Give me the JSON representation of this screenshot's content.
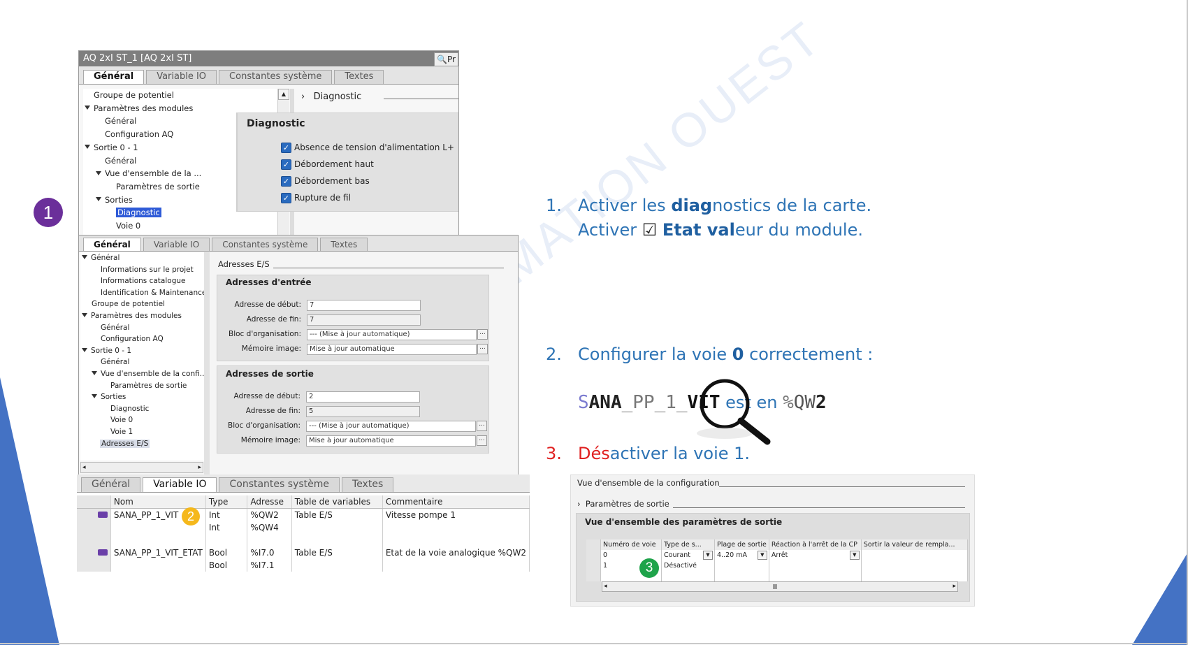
{
  "colors": {
    "accent_blue": "#2e74b5",
    "step_red": "#e02020",
    "badge1": "#6b2f9a",
    "badge2": "#f5b81c",
    "badge3": "#1ea34a",
    "slide_triangle": "#4472c4"
  },
  "badges": {
    "b1": "1",
    "b2": "2",
    "b3": "3"
  },
  "panel1": {
    "title": "AQ 2xI ST_1 [AQ 2xI ST]",
    "corner_button": "Pr",
    "tabs": [
      "Général",
      "Variable IO",
      "Constantes système",
      "Textes"
    ],
    "tree": [
      "Groupe de potentiel",
      "Paramètres des modules",
      "Général",
      "Configuration AQ",
      "Sortie 0 - 1",
      "Général",
      "Vue d'ensemble de la ...",
      "Paramètres de sortie",
      "Sorties",
      "Diagnostic",
      "Voie 0"
    ],
    "section_header": "Diagnostic",
    "box_title": "Diagnostic",
    "checkboxes": [
      "Absence de tension d'alimentation L+",
      "Débordement haut",
      "Débordement bas",
      "Rupture de fil"
    ]
  },
  "panel2": {
    "tabs": [
      "Général",
      "Variable IO",
      "Constantes système",
      "Textes"
    ],
    "tree": [
      "Général",
      "Informations sur le projet",
      "Informations catalogue",
      "Identification & Maintenance",
      "Groupe de potentiel",
      "Paramètres des modules",
      "Général",
      "Configuration AQ",
      "Sortie 0 - 1",
      "Général",
      "Vue d'ensemble de la confi...",
      "Paramètres de sortie",
      "Sorties",
      "Diagnostic",
      "Voie 0",
      "Voie 1",
      "Adresses E/S"
    ],
    "section_header": "Adresses E/S",
    "input": {
      "title": "Adresses d'entrée",
      "labels": [
        "Adresse de début:",
        "Adresse de fin:",
        "Bloc d'organisation:",
        "Mémoire image:"
      ],
      "values": [
        "7",
        "7",
        "--- (Mise à jour automatique)",
        "Mise à jour automatique"
      ]
    },
    "output": {
      "title": "Adresses de sortie",
      "labels": [
        "Adresse de début:",
        "Adresse de fin:",
        "Bloc d'organisation:",
        "Mémoire image:"
      ],
      "values": [
        "2",
        "5",
        "--- (Mise à jour automatique)",
        "Mise à jour automatique"
      ]
    }
  },
  "panel3": {
    "tabs": [
      "Général",
      "Variable IO",
      "Constantes système",
      "Textes"
    ],
    "headers": [
      "Nom",
      "Type",
      "Adresse",
      "Table de variables",
      "Commentaire"
    ],
    "rows": [
      {
        "nom": "SANA_PP_1_VIT",
        "type": "Int",
        "adresse": "%QW2",
        "table": "Table E/S",
        "commentaire": "Vitesse pompe 1"
      },
      {
        "nom": "",
        "type": "Int",
        "adresse": "%QW4",
        "table": "",
        "commentaire": ""
      },
      {
        "nom": "",
        "type": "",
        "adresse": "",
        "table": "",
        "commentaire": ""
      },
      {
        "nom": "SANA_PP_1_VIT_ETAT",
        "type": "Bool",
        "adresse": "%I7.0",
        "table": "Table E/S",
        "commentaire": "Etat de la voie analogique %QW2"
      },
      {
        "nom": "",
        "type": "Bool",
        "adresse": "%I7.1",
        "table": "",
        "commentaire": ""
      }
    ]
  },
  "steps": {
    "s1_num": "1.",
    "s1_l1a": "Activer les ",
    "s1_l1b": "diag",
    "s1_l1c": "nostics de la carte.",
    "s1_l2a": "Activer ",
    "s1_l2box": "☑",
    "s1_l2b": "Etat val",
    "s1_l2c": "eur du module.",
    "s2_num": "2.",
    "s2_a": "Configurer la voie ",
    "s2_b": "0",
    "s2_c": " correctement :",
    "s2_code_s": "S",
    "s2_code_ana": "ANA",
    "s2_code_mid": "_PP_1_",
    "s2_code_vit": "VIT",
    "s2_code_est": " est en ",
    "s2_code_pct": "%",
    "s2_code_q": "QW",
    "s2_code_2": "2",
    "s3_num": "3.",
    "s3_a": "Dés",
    "s3_b": "activer la voie ",
    "s3_c": "1."
  },
  "panel4": {
    "header1": "Vue d'ensemble de la configuration",
    "header2": "Paramètres de sortie",
    "box_title": "Vue d'ensemble des paramètres de sortie",
    "columns": [
      "Numéro de voie",
      "Type de s...",
      "Plage de sortie",
      "Réaction à l'arrêt de la CP",
      "Sortir la valeur de rempla..."
    ],
    "rows": [
      {
        "voie": "0",
        "type": "Courant",
        "plage": "4..20 mA",
        "reaction": "Arrêt",
        "valeur": ""
      },
      {
        "voie": "1",
        "type": "Désactivé",
        "plage": "",
        "reaction": "",
        "valeur": ""
      }
    ]
  },
  "watermark": "MATION OUEST"
}
